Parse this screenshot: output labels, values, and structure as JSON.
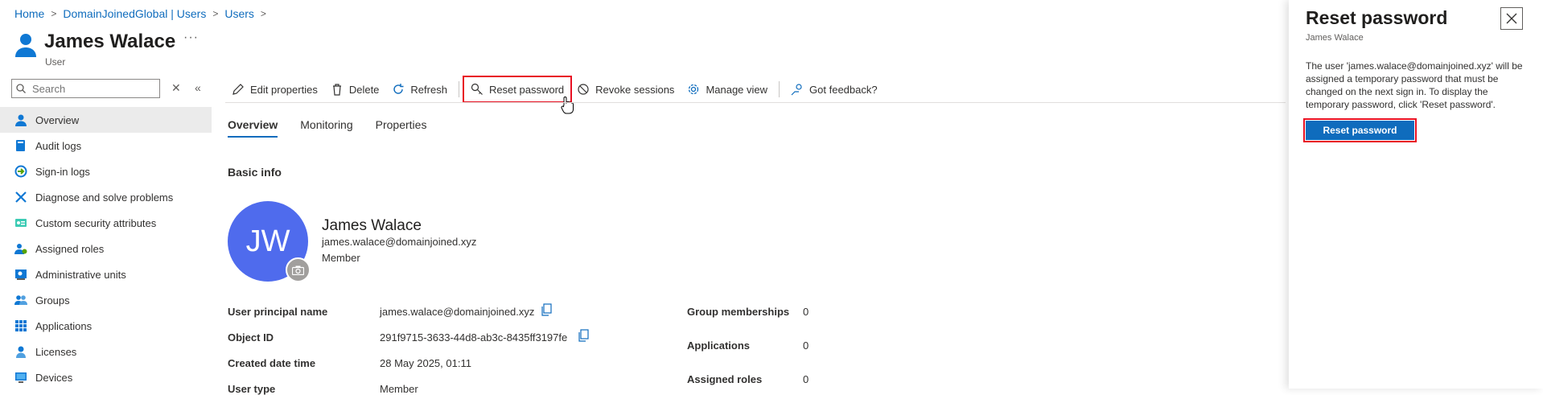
{
  "breadcrumb": {
    "items": [
      "Home",
      "DomainJoinedGlobal | Users",
      "Users"
    ],
    "separator": ">"
  },
  "header": {
    "title": "James Walace",
    "subtitle": "User",
    "more": "···"
  },
  "sidebar": {
    "search": {
      "placeholder": "Search",
      "value": ""
    },
    "clear": "✕",
    "collapse": "«",
    "items": [
      {
        "label": "Overview",
        "icon": "user-icon",
        "active": true
      },
      {
        "label": "Audit logs",
        "icon": "book-icon"
      },
      {
        "label": "Sign-in logs",
        "icon": "sign-in-icon"
      },
      {
        "label": "Diagnose and solve problems",
        "icon": "wrench-icon"
      },
      {
        "label": "Custom security attributes",
        "icon": "attributes-icon"
      },
      {
        "label": "Assigned roles",
        "icon": "roles-icon"
      },
      {
        "label": "Administrative units",
        "icon": "admin-units-icon"
      },
      {
        "label": "Groups",
        "icon": "groups-icon"
      },
      {
        "label": "Applications",
        "icon": "grid-icon"
      },
      {
        "label": "Licenses",
        "icon": "license-icon"
      },
      {
        "label": "Devices",
        "icon": "device-icon"
      }
    ]
  },
  "toolbar": {
    "edit": "Edit properties",
    "delete": "Delete",
    "refresh": "Refresh",
    "reset": "Reset password",
    "revoke": "Revoke sessions",
    "manage": "Manage view",
    "feedback": "Got feedback?"
  },
  "tabs": [
    "Overview",
    "Monitoring",
    "Properties"
  ],
  "basic_info": {
    "title": "Basic info",
    "initials": "JW",
    "name": "James Walace",
    "email": "james.walace@domainjoined.xyz",
    "type": "Member"
  },
  "properties": {
    "upn": {
      "label": "User principal name",
      "value": "james.walace@domainjoined.xyz"
    },
    "object_id": {
      "label": "Object ID",
      "value": "291f9715-3633-44d8-ab3c-8435ff3197fe"
    },
    "created": {
      "label": "Created date time",
      "value": "28 May 2025, 01:11"
    },
    "user_type": {
      "label": "User type",
      "value": "Member"
    }
  },
  "stats": {
    "groups": {
      "label": "Group memberships",
      "value": "0"
    },
    "apps": {
      "label": "Applications",
      "value": "0"
    },
    "roles": {
      "label": "Assigned roles",
      "value": "0"
    }
  },
  "panel": {
    "title": "Reset password",
    "subtitle": "James Walace",
    "description": "The user 'james.walace@domainjoined.xyz' will be assigned a temporary password that must be changed on the next sign in. To display the temporary password, click 'Reset password'.",
    "button": "Reset password"
  },
  "colors": {
    "accent": "#0f6cbd",
    "highlight": "#e81123",
    "avatar": "#4f6bed"
  }
}
